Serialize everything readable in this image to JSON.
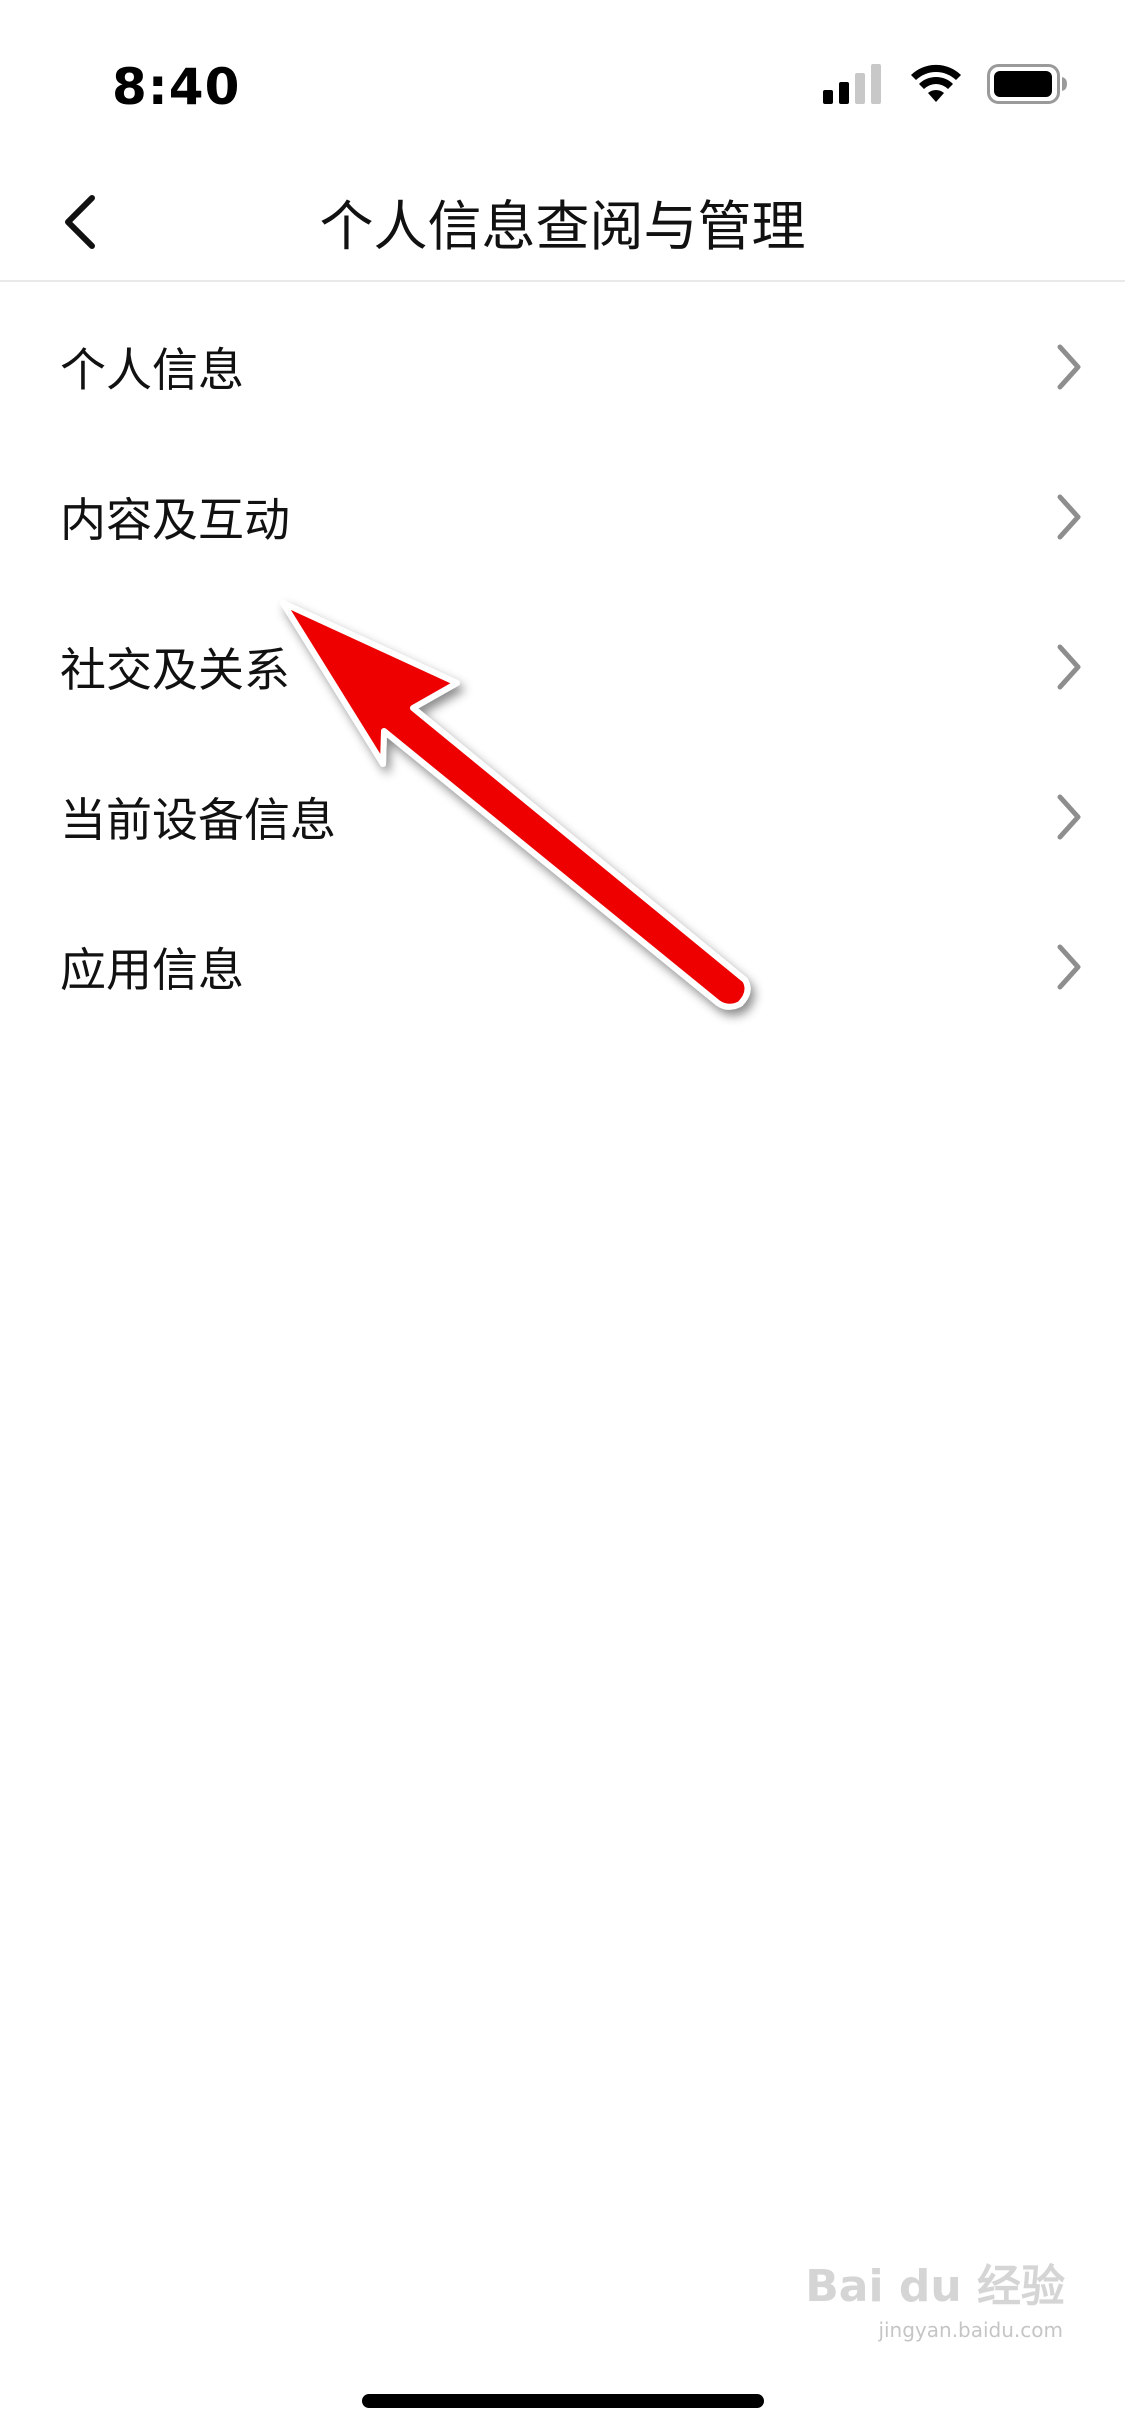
{
  "status_bar": {
    "time": "8:40",
    "signal_icon": "cellular-signal-icon",
    "wifi_icon": "wifi-icon",
    "battery_icon": "battery-icon"
  },
  "nav": {
    "title": "个人信息查阅与管理",
    "back_icon": "chevron-left-icon"
  },
  "menu": {
    "items": [
      {
        "label": "个人信息"
      },
      {
        "label": "内容及互动"
      },
      {
        "label": "社交及关系"
      },
      {
        "label": "当前设备信息"
      },
      {
        "label": "应用信息"
      }
    ],
    "chevron_icon": "chevron-right-icon"
  },
  "annotation": {
    "color": "#ee0000",
    "points_to": "内容及互动"
  },
  "watermark": {
    "text": "Bai du 经验",
    "sub": "jingyan.baidu.com"
  }
}
